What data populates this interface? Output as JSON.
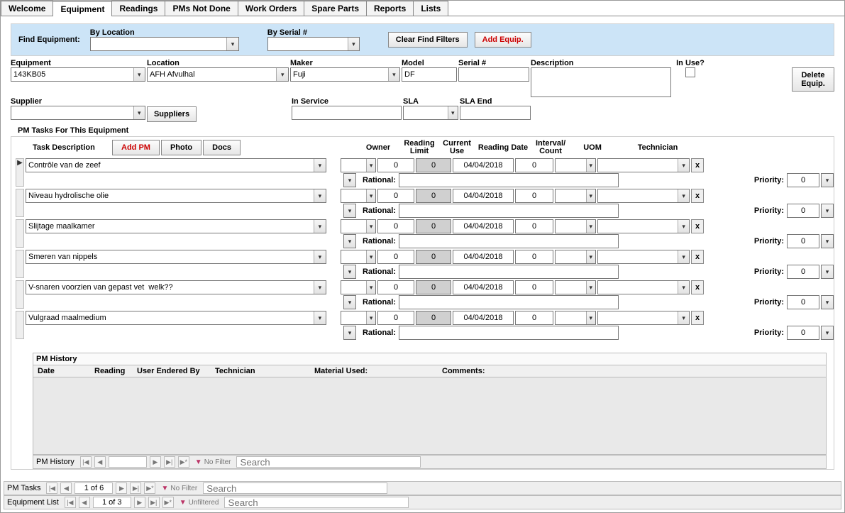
{
  "tabs": [
    "Welcome",
    "Equipment",
    "Readings",
    "PMs Not Done",
    "Work Orders",
    "Spare Parts",
    "Reports",
    "Lists"
  ],
  "active_tab": "Equipment",
  "find": {
    "label": "Find Equipment:",
    "by_location": "By Location",
    "by_serial": "By Serial #",
    "clear": "Clear Find Filters",
    "add": "Add Equip."
  },
  "eq_labels": {
    "equipment": "Equipment",
    "location": "Location",
    "maker": "Maker",
    "model": "Model",
    "serial": "Serial #",
    "description": "Description",
    "in_use": "In Use?",
    "supplier": "Supplier",
    "suppliers_btn": "Suppliers",
    "in_service": "In Service",
    "sla": "SLA",
    "sla_end": "SLA End",
    "delete": "Delete Equip."
  },
  "eq_values": {
    "equipment": "143KB05",
    "location": "AFH Afvulhal",
    "maker": "Fuji",
    "model": "DF",
    "serial": "",
    "description": "",
    "supplier": "",
    "in_service": "",
    "sla": "",
    "sla_end": ""
  },
  "pm_section": "PM Tasks For This Equipment",
  "pm_head": {
    "task": "Task Description",
    "add": "Add PM",
    "photo": "Photo",
    "docs": "Docs",
    "owner": "Owner",
    "reading_limit": "Reading Limit",
    "current_use": "Current Use",
    "reading_date": "Reading Date",
    "interval": "Interval/ Count",
    "uom": "UOM",
    "technician": "Technician",
    "rational": "Rational:",
    "priority": "Priority:"
  },
  "pm_rows": [
    {
      "desc": "Contrôle van de zeef",
      "reading_limit": "0",
      "current_use": "0",
      "reading_date": "04/04/2018",
      "interval": "0",
      "priority": "0",
      "selected": true
    },
    {
      "desc": "Niveau hydrolische olie",
      "reading_limit": "0",
      "current_use": "0",
      "reading_date": "04/04/2018",
      "interval": "0",
      "priority": "0",
      "selected": false
    },
    {
      "desc": "Slijtage maalkamer",
      "reading_limit": "0",
      "current_use": "0",
      "reading_date": "04/04/2018",
      "interval": "0",
      "priority": "0",
      "selected": false
    },
    {
      "desc": "Smeren van nippels",
      "reading_limit": "0",
      "current_use": "0",
      "reading_date": "04/04/2018",
      "interval": "0",
      "priority": "0",
      "selected": false
    },
    {
      "desc": "V-snaren voorzien van gepast vet  welk??",
      "reading_limit": "0",
      "current_use": "0",
      "reading_date": "04/04/2018",
      "interval": "0",
      "priority": "0",
      "selected": false
    },
    {
      "desc": "Vulgraad maalmedium",
      "reading_limit": "0",
      "current_use": "0",
      "reading_date": "04/04/2018",
      "interval": "0",
      "priority": "0",
      "selected": false
    }
  ],
  "history": {
    "title": "PM History",
    "cols": {
      "date": "Date",
      "reading": "Reading",
      "user": "User Endered By",
      "technician": "Technician",
      "material": "Material Used:",
      "comments": "Comments:"
    }
  },
  "nav": {
    "pm_history": {
      "label": "PM History",
      "count": "",
      "filter": "No Filter",
      "search": "Search"
    },
    "pm_tasks": {
      "label": "PM Tasks",
      "count": "1 of 6",
      "filter": "No Filter",
      "search": "Search"
    },
    "equipment_list": {
      "label": "Equipment List",
      "count": "1 of 3",
      "filter": "Unfiltered",
      "search": "Search"
    }
  },
  "glyphs": {
    "first": "|◀",
    "prev": "◀",
    "next": "▶",
    "last": "▶|",
    "new": "▶*",
    "drop": "▾",
    "sel": "▶",
    "x": "x",
    "funnel": "▼"
  }
}
